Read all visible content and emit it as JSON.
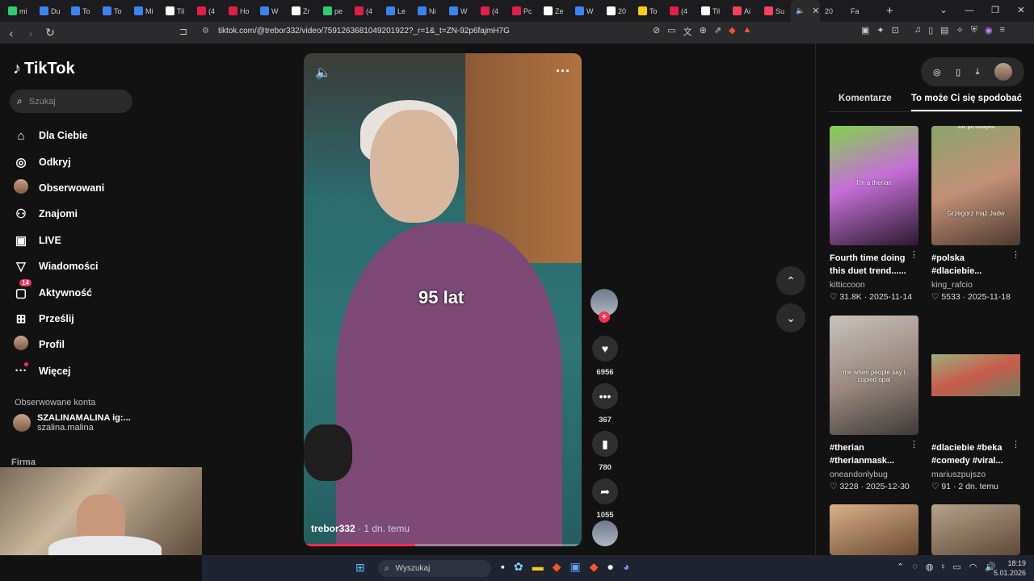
{
  "browser": {
    "tabs": [
      {
        "label": "mi",
        "color": "#2ecc71"
      },
      {
        "label": "Du",
        "color": "#3b82f6"
      },
      {
        "label": "To",
        "color": "#3b82f6"
      },
      {
        "label": "To",
        "color": "#3b82f6"
      },
      {
        "label": "Mi",
        "color": "#3b82f6"
      },
      {
        "label": "Til",
        "color": "#ffffff"
      },
      {
        "label": "(4",
        "color": "#e11d48"
      },
      {
        "label": "Ho",
        "color": "#e11d48"
      },
      {
        "label": "W",
        "color": "#3b82f6"
      },
      {
        "label": "Zr",
        "color": "#ffffff"
      },
      {
        "label": "pe",
        "color": "#2ecc71"
      },
      {
        "label": "(4",
        "color": "#e11d48"
      },
      {
        "label": "Le",
        "color": "#3b82f6"
      },
      {
        "label": "Ni",
        "color": "#3b82f6"
      },
      {
        "label": "W",
        "color": "#3b82f6"
      },
      {
        "label": "(4",
        "color": "#e11d48"
      },
      {
        "label": "Pc",
        "color": "#e11d48"
      },
      {
        "label": "Ze",
        "color": "#ffffff"
      },
      {
        "label": "W",
        "color": "#3b82f6"
      },
      {
        "label": "20",
        "color": "#ffffff"
      },
      {
        "label": "To",
        "color": "#facc15"
      },
      {
        "label": "(4",
        "color": "#e11d48"
      },
      {
        "label": "Til",
        "color": "#ffffff"
      },
      {
        "label": "Ai",
        "color": "#f43f5e"
      },
      {
        "label": "Su",
        "color": "#f43f5e"
      }
    ],
    "active_tab_icon": "speaker-icon",
    "after_tabs": [
      {
        "label": "20"
      },
      {
        "label": "Fa"
      }
    ],
    "url": "tiktok.com/@trebor332/video/7591263681049201922?_r=1&_t=ZN-92p6fajmH7G"
  },
  "sidebar": {
    "logo": "TikTok",
    "search_placeholder": "Szukaj",
    "items": [
      {
        "label": "Dla Ciebie",
        "icon": "⌂",
        "name": "home-icon"
      },
      {
        "label": "Odkryj",
        "icon": "◎",
        "name": "compass-icon"
      },
      {
        "label": "Obserwowani",
        "icon": "●",
        "name": "following-avatar-icon"
      },
      {
        "label": "Znajomi",
        "icon": "⚇",
        "name": "friends-icon"
      },
      {
        "label": "LIVE",
        "icon": "▣",
        "name": "live-icon"
      },
      {
        "label": "Wiadomości",
        "icon": "▽",
        "name": "messages-icon"
      },
      {
        "label": "Aktywność",
        "icon": "▢",
        "name": "activity-icon",
        "badge": "14"
      },
      {
        "label": "Prześlij",
        "icon": "⊞",
        "name": "upload-icon"
      },
      {
        "label": "Profil",
        "icon": "●",
        "name": "profile-avatar-icon"
      },
      {
        "label": "Więcej",
        "icon": "···",
        "name": "more-icon",
        "dot": true
      }
    ],
    "following_header": "Obserwowane konta",
    "following_account": {
      "name": "SZALINAMALINA ig:...",
      "handle": "szalina.malina"
    },
    "company_label": "Firma"
  },
  "video": {
    "caption": "95 lat",
    "author": "trebor332",
    "time": "· 1 dn. temu",
    "progress": 0.4
  },
  "actions": {
    "likes": "6956",
    "comments": "367",
    "saves": "780",
    "shares": "1055"
  },
  "right_panel": {
    "tabs": [
      "Komentarze",
      "To może Ci się spodobać"
    ],
    "active_tab": 1,
    "cards": [
      {
        "title": "Fourth time doing this duet trend......",
        "user": "kitticcoon",
        "likes": "31.8K",
        "date": "2025-11-14",
        "overlay": "I'm a therian",
        "bg": "linear-gradient(160deg,#7fd34a 0%,#c66fd8 45%,#2a1b2e 100%)"
      },
      {
        "title": "#polska #dlaciebie...",
        "user": "king_rafcio",
        "likes": "5533",
        "date": "2025-11-18",
        "overlay": "Grzegorz mąż Jadw",
        "top_text": "Juz po obwyku",
        "bg": "linear-gradient(160deg,#8aa56b 0%,#c39077 50%,#4b3a2f 100%)"
      },
      {
        "title": "#therian #therianmask...",
        "user": "oneandonlybug",
        "likes": "3228",
        "date": "2025-12-30",
        "overlay": "me when people say i copied opal",
        "bg": "linear-gradient(160deg,#c8c2bd 0%,#9b8a80 50%,#3e3a38 100%)"
      },
      {
        "title": "#dlaciebie #beka #comedy #viral...",
        "user": "mariuszpujszo",
        "likes": "91",
        "date": "2 dn. temu",
        "overlay": "",
        "bg": "linear-gradient(160deg,#9bb07c 0%,#c95b4b 50%,#6f7f5f 100%)"
      }
    ]
  },
  "taskbar": {
    "search_placeholder": "Wyszukaj",
    "time": "18:19",
    "date": "5.01.2026"
  }
}
